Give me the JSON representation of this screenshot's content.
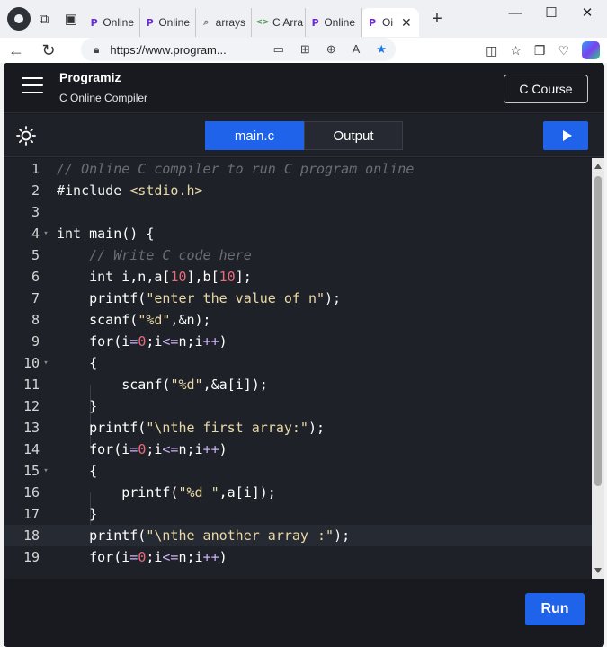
{
  "browser": {
    "tabs": [
      {
        "label": "Online",
        "icon": "programiz-icon"
      },
      {
        "label": "Online",
        "icon": "programiz-icon"
      },
      {
        "label": "arrays",
        "icon": "search-icon"
      },
      {
        "label": "C Arra",
        "icon": "code-icon"
      },
      {
        "label": "Online",
        "icon": "programiz-icon"
      },
      {
        "label": "Oi",
        "icon": "programiz-icon"
      }
    ],
    "url": "https://www.program..."
  },
  "header": {
    "brand": "Programiz",
    "subtitle": "C Online Compiler",
    "course_button": "C Course"
  },
  "toolbar": {
    "file_tab": "main.c",
    "output_tab": "Output"
  },
  "editor": {
    "line_numbers": [
      "1",
      "2",
      "3",
      "4",
      "5",
      "6",
      "7",
      "8",
      "9",
      "10",
      "11",
      "12",
      "13",
      "14",
      "15",
      "16",
      "17",
      "18",
      "19"
    ]
  },
  "run_button": "Run",
  "colors": {
    "accent": "#1e63e9",
    "background": "#181a20",
    "editor_bg": "#1e2128"
  }
}
